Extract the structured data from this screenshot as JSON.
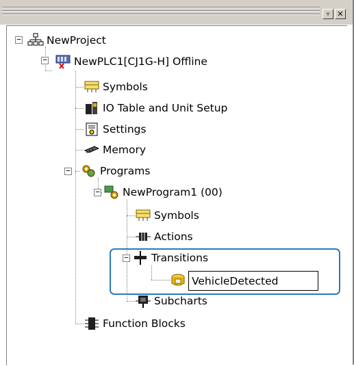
{
  "titlebar": {
    "dropdown_icon": "triangle-down-icon",
    "close_icon": "close-icon"
  },
  "tree": {
    "project": "NewProject",
    "plc": "NewPLC1[CJ1G-H] Offline",
    "plc_children": {
      "symbols": "Symbols",
      "io_table": "IO Table and Unit Setup",
      "settings": "Settings",
      "memory": "Memory",
      "programs": "Programs"
    },
    "program": "NewProgram1 (00)",
    "program_children": {
      "symbols": "Symbols",
      "actions": "Actions",
      "transitions": "Transitions",
      "subcharts": "Subcharts"
    },
    "editing_value": "VehicleDetected",
    "function_blocks": "Function Blocks"
  },
  "colors": {
    "highlight": "#2e77b5",
    "titlebar": "#d4d0c8"
  }
}
